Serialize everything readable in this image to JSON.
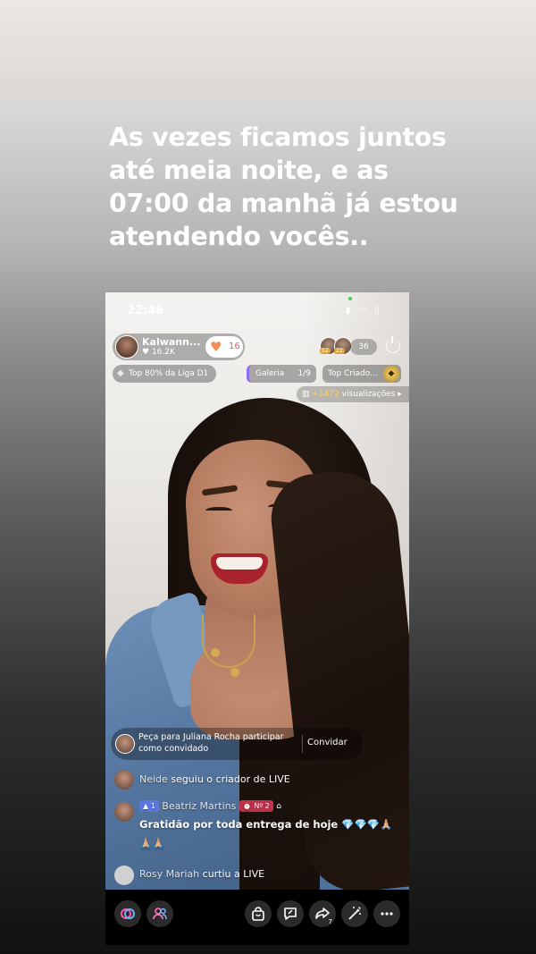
{
  "caption": "As vezes ficamos juntos até meia noite, e as 07:00 da manhã já estou atendendo vocês..",
  "status_bar": {
    "time": "22:46"
  },
  "host": {
    "name": "Kalwann...",
    "likes": "16.2K",
    "follow_count": "16"
  },
  "viewers": {
    "count": "36",
    "badge_1": "52",
    "badge_2": "22"
  },
  "chips": {
    "league": "Top 80% da Liga D1",
    "gallery": "Galeria",
    "gallery_count": "1/9",
    "top_creators": "Top Criado..."
  },
  "views": {
    "plus": "+1472",
    "label": "visualizações"
  },
  "invite": {
    "text": "Peça para Juliana Rocha participar como convidado",
    "button": "Convidar"
  },
  "comments": [
    {
      "name": "Neide",
      "text": "seguiu o criador de LIVE"
    },
    {
      "name": "Beatriz Martins",
      "level": "1",
      "fan_badge": "Nº 2",
      "message": "Gratidão por toda entrega de hoje 💎💎💎🙏🏼🙏🏼🙏🏼"
    },
    {
      "name": "Rosy Mariah",
      "text": "curtiu a LIVE"
    }
  ],
  "bottom_bar": {
    "icons": [
      "link-icon",
      "users-icon",
      "shopping-bag-icon",
      "chat-icon",
      "share-icon",
      "magic-wand-icon",
      "more-icon"
    ],
    "share_count": "7"
  },
  "colors": {
    "accent_follow": "#f58c57",
    "level_badge": "#5b77e0",
    "fan_badge": "#c2314d"
  }
}
